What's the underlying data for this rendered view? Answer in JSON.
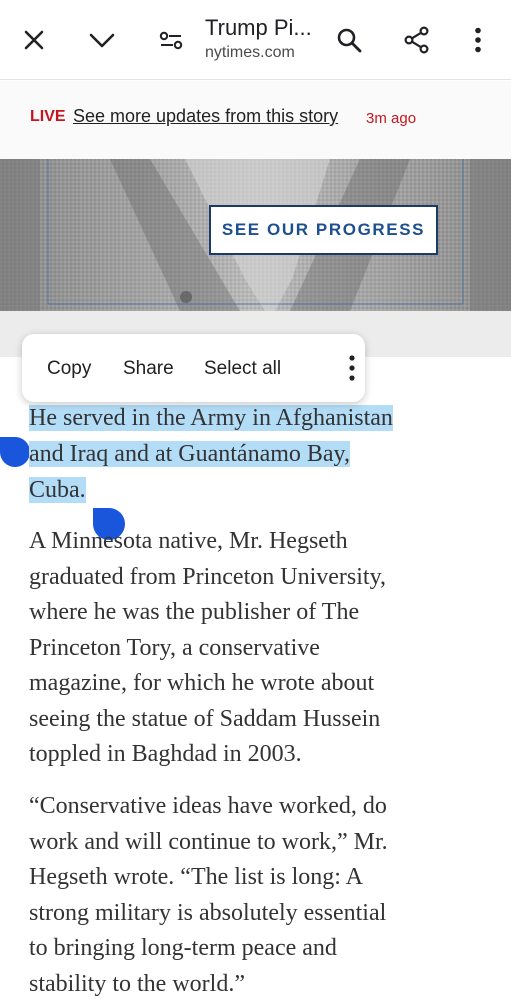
{
  "toolbar": {
    "title": "Trump Pi...",
    "domain": "nytimes.com"
  },
  "live": {
    "label": "LIVE",
    "link_text": "See more updates from this story",
    "time": "3m ago"
  },
  "banner": {
    "button_label": "SEE OUR PROGRESS"
  },
  "context_menu": {
    "items": [
      "Copy",
      "Share",
      "Select all"
    ]
  },
  "article": {
    "selected_lines": [
      "He served in the Army in Afghanistan",
      "and Iraq and at Guantánamo Bay,",
      "Cuba."
    ],
    "paragraph2": [
      "A Minnesota native, Mr. Hegseth",
      "graduated from Princeton University,",
      "where he was the publisher of The",
      "Princeton Tory, a conservative",
      "magazine, for which he wrote about",
      "seeing the statue of Saddam Hussein",
      "toppled in Baghdad in 2003."
    ],
    "paragraph3": [
      "“Conservative ideas have worked, do",
      "work and will continue to work,” Mr.",
      "Hegseth wrote. “The list is long: A",
      "strong military is absolutely essential",
      "to bringing long-term peace and",
      "stability to the world.”"
    ]
  },
  "colors": {
    "live_red": "#c4161c",
    "selection": "#b3dcf7",
    "handle_blue": "#1a56db",
    "button_blue": "#1d4f91"
  }
}
